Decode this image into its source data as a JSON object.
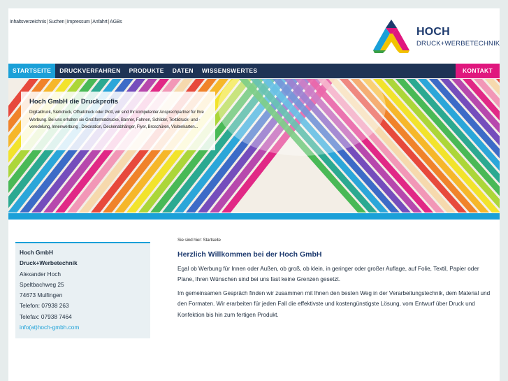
{
  "toplinks": [
    "Inhaltsverzeichnis",
    "Suchen",
    "Impressum",
    "Anfahrt",
    "AGBs"
  ],
  "toplink_separator": "|",
  "logo": {
    "name": "HOCH",
    "subtitle": "DRUCK+WERBETECHNIK",
    "colors": [
      "#1d3a6e",
      "#e0177e",
      "#f2c300",
      "#1aa0d8",
      "#3aa046"
    ]
  },
  "nav": {
    "items": [
      "STARTSEITE",
      "DRUCKVERFAHREN",
      "PRODUKTE",
      "DATEN",
      "WISSENSWERTES"
    ],
    "active_index": 0,
    "contact": "KONTAKT"
  },
  "banner": {
    "title": "Hoch GmbH die Druckprofis",
    "text": "Digitaldruck, Siebdruck, Offsetdruck oder Plott, wir sind Ihr kompetenter Ansprechpartner für Ihre Werbung. Bei uns erhalten sie Großformatdrucke, Banner, Fahnen, Schilder, Textildruck- und -veredelung, Innenwerbung , Dekoration, Deckenabhänger, Flyer, Broschüren, Visitenkarten..."
  },
  "contact": {
    "lines": [
      "Hoch GmbH",
      "Druck+Werbetechnik",
      "Alexander Hoch",
      "Speltbachweg 25",
      "74673 Mulfingen",
      "Telefon: 07938 263",
      "Telefax: 07938 7464"
    ],
    "email": "info(at)hoch-gmbh.com"
  },
  "breadcrumb": "Sie sind hier: Startseite",
  "main": {
    "title": "Herzlich Willkommen bei der Hoch GmbH",
    "paragraphs": [
      "Egal ob Werbung für Innen oder Außen, ob groß, ob klein, in geringer oder großer Auflage, auf Folie, Textil, Papier oder Plane, Ihren Wünschen sind bei uns fast keine Grenzen gesetzt.",
      "Im gemeinsamen Gespräch finden wir zusammen mit Ihnen den besten Weg in der Verarbeitungstechnik, dem Material und den Formaten. Wir erarbeiten für jeden Fall die effektivste und kostengünstigste Lösung, vom Entwurf über Druck und Konfektion bis hin zum fertigen Produkt."
    ]
  },
  "accent_colors": {
    "nav_bg": "#1e3355",
    "active": "#1aa0d8",
    "contact_bg": "#e0177e"
  }
}
